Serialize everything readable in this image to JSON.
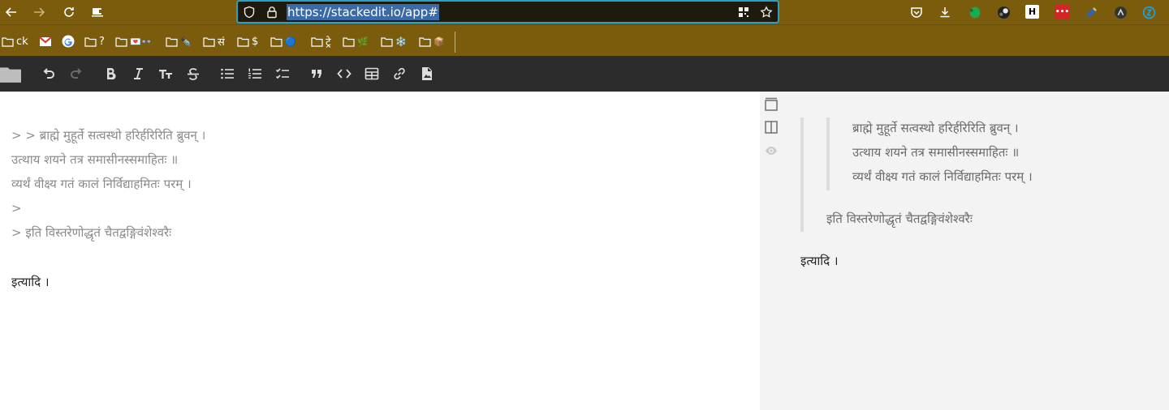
{
  "browser": {
    "url": "https://stackedit.io/app#",
    "accent_color": "#7a5c0c",
    "nav_icons": [
      "back-icon",
      "forward-icon",
      "reload-icon",
      "screen-icon"
    ],
    "ext_icons": [
      "pocket-icon",
      "download-icon",
      "evernote-icon",
      "avatar-icon",
      "hn-icon",
      "lastpass-icon",
      "pen-icon",
      "ext-icon",
      "sync-icon"
    ],
    "ext_hn_label": "H",
    "ext_lastpass_label": "•••"
  },
  "bookmarks": [
    {
      "label": "ck",
      "icon": "folder-icon"
    },
    {
      "label": "",
      "icon": "gmail-icon"
    },
    {
      "label": "",
      "icon": "google-icon"
    },
    {
      "label": "?",
      "icon": "folder-icon"
    },
    {
      "label": "💌👓",
      "icon": "folder-icon"
    },
    {
      "label": "✒️",
      "icon": "folder-icon"
    },
    {
      "label": "सं",
      "icon": "folder-icon"
    },
    {
      "label": "$",
      "icon": "folder-icon"
    },
    {
      "label": "🔵",
      "icon": "folder-icon"
    },
    {
      "label": "ट्रे",
      "icon": "folder-icon"
    },
    {
      "label": "🌿",
      "icon": "folder-icon"
    },
    {
      "label": "❄️",
      "icon": "folder-icon"
    },
    {
      "label": "📦",
      "icon": "folder-icon"
    }
  ],
  "editor_toolbar": {
    "buttons": [
      "folder-icon",
      "undo-icon",
      "redo-icon",
      "bold-icon",
      "italic-icon",
      "heading-icon",
      "strikethrough-icon",
      "bulleted-list-icon",
      "numbered-list-icon",
      "checklist-icon",
      "quote-icon",
      "code-icon",
      "table-icon",
      "link-icon",
      "image-icon"
    ]
  },
  "editor": {
    "lines": [
      "> > ब्राह्मे मुहूर्ते सत्वस्थो हरिर्हरिरिति ब्रुवन् ।",
      "उत्थाय शयने तत्र समासीनस्समाहितः ॥",
      "व्यर्थं वीक्ष्य गतं कालं निर्विद्याहमितः परम् ।",
      ">",
      "> इति विस्तरेणोद्धृतं चैतद्वङ्गिवंशेश्वरैः",
      "",
      "इत्यादि ।"
    ]
  },
  "preview": {
    "inner_quote": [
      "ब्राह्मे मुहूर्ते सत्वस्थो हरिर्हरिरिति ब्रुवन् ।",
      "उत्थाय शयने तत्र समासीनस्समाहितः ॥",
      "व्यर्थं वीक्ष्य गतं कालं निर्विद्याहमितः परम् ।"
    ],
    "outer_quote_line": "इति विस्तरेणोद्धृतं चैतद्वङ्गिवंशेश्वरैः",
    "paragraph": "इत्यादि ।"
  },
  "side_tools": [
    "toggle-navbar-icon",
    "side-by-side-icon",
    "preview-eye-icon"
  ]
}
